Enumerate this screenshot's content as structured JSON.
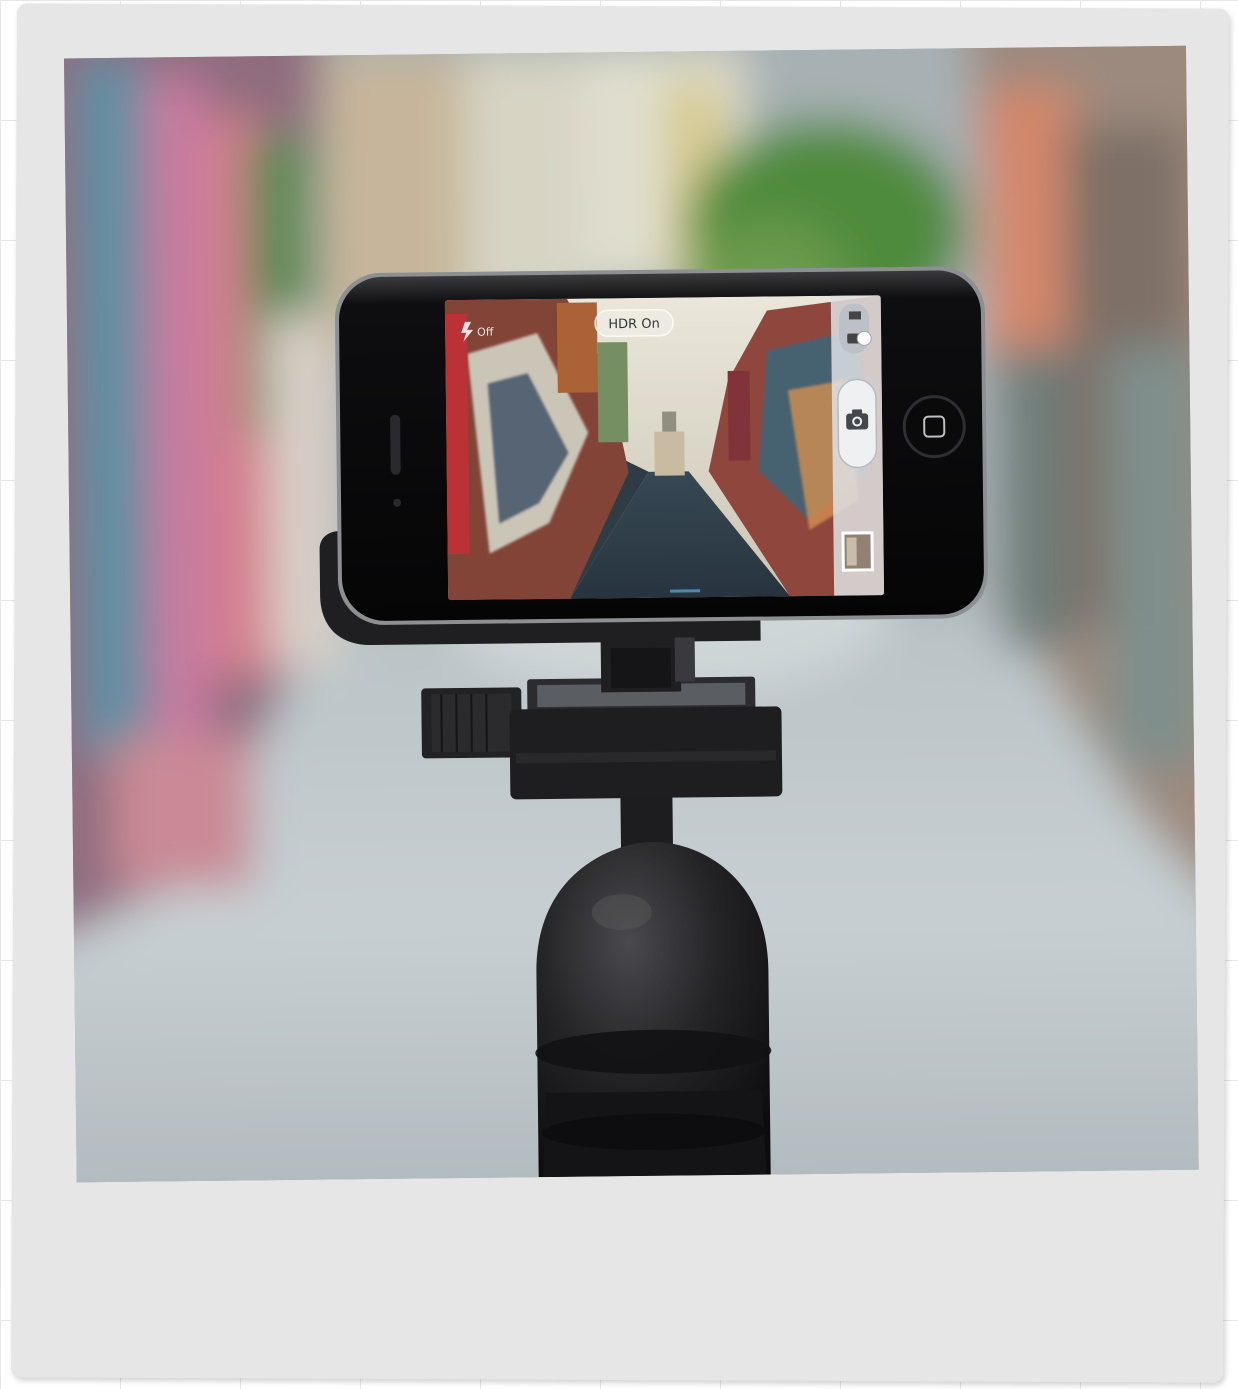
{
  "photo": {
    "phone_screen": {
      "hdr_label": "HDR On",
      "flash_label": "Off"
    }
  },
  "colors": {
    "polaroid_frame": "#e6e6e6",
    "background_paper": "#ffffff",
    "tripod": "#1c1c1e",
    "phone_body": "#0d0d0f"
  }
}
